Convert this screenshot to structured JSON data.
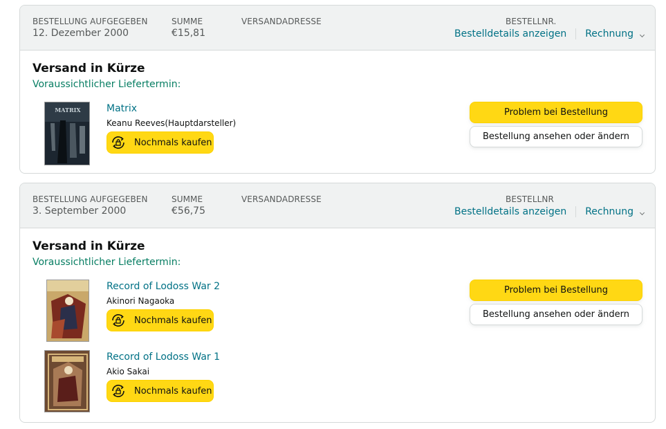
{
  "labels": {
    "order_placed": "BESTELLUNG AUFGEGEBEN",
    "total": "SUMME",
    "ship_to": "VERSANDADRESSE",
    "order_details": "Bestelldetails anzeigen",
    "invoice": "Rechnung",
    "ship_status": "Versand in Kürze",
    "delivery": "Voraussichtlicher Liefertermin:",
    "buy_again": "Nochmals kaufen",
    "problem": "Problem bei Bestellung",
    "view_edit": "Bestellung ansehen oder ändern"
  },
  "orders": [
    {
      "order_nr_label": "BESTELLNR.",
      "date": "12. Dezember 2000",
      "total": "€15,81",
      "items": [
        {
          "title": "Matrix",
          "author": "Keanu Reeves(Hauptdarsteller)"
        }
      ]
    },
    {
      "order_nr_label": "BESTELLNR",
      "date": "3. September 2000",
      "total": "€56,75",
      "items": [
        {
          "title": "Record of Lodoss War 2",
          "author": "Akinori Nagaoka"
        },
        {
          "title": "Record of Lodoss War 1",
          "author": "Akio Sakai"
        }
      ]
    }
  ],
  "colors": {
    "link": "#007185",
    "accent_button": "#ffd814",
    "delivery_text": "#067d62",
    "header_bg": "#f0f2f2"
  },
  "icons": {
    "buy_again": "refresh-lock-icon",
    "invoice_toggle": "chevron-down-icon"
  }
}
